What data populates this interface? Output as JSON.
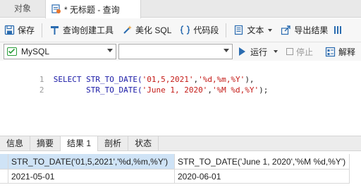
{
  "tabs": {
    "objects": "对象",
    "query": "* 无标题 - 查询"
  },
  "toolbar": {
    "save": "保存",
    "query_builder": "查询创建工具",
    "beautify": "美化 SQL",
    "code_snippet": "代码段",
    "text": "文本",
    "export": "导出结果"
  },
  "selectors": {
    "connection": "MySQL",
    "database": "",
    "run": "运行",
    "stop": "停止",
    "explain": "解释"
  },
  "editor": {
    "lines": [
      {
        "number": "1",
        "indent": "  ",
        "kw": "SELECT",
        "fn": " STR_TO_DATE(",
        "s1": "'01,5,2021'",
        "comma": ",",
        "s2": "'%d,%m,%Y'",
        "tail": "),"
      },
      {
        "number": "2",
        "indent": "         ",
        "kw": "",
        "fn": "STR_TO_DATE(",
        "s1": "'June 1, 2020'",
        "comma": ",",
        "s2": "'%M %d,%Y'",
        "tail": ");"
      }
    ]
  },
  "result_tabs": [
    "信息",
    "摘要",
    "结果 1",
    "剖析",
    "状态"
  ],
  "grid": {
    "headers": [
      "STR_TO_DATE('01,5,2021','%d,%m,%Y')",
      "STR_TO_DATE('June 1, 2020','%M %d,%Y')"
    ],
    "rows": [
      [
        "2021-05-01",
        "2020-06-01"
      ]
    ]
  },
  "colors": {
    "keyword": "#1a1aa6",
    "string": "#c41a16",
    "selected_header": "#cfe3f6"
  }
}
